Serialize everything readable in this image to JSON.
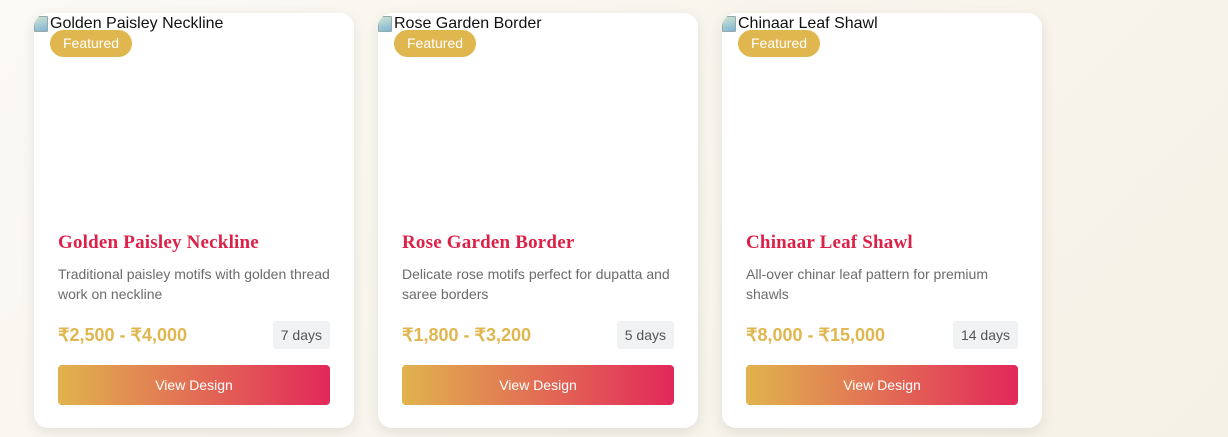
{
  "cards": [
    {
      "image_alt": "Golden Paisley Neckline",
      "badge": "Featured",
      "title": "Golden Paisley Neckline",
      "description": "Traditional paisley motifs with golden thread work on neckline",
      "price": "₹2,500 - ₹4,000",
      "days": "7 days",
      "button": "View Design"
    },
    {
      "image_alt": "Rose Garden Border",
      "badge": "Featured",
      "title": "Rose Garden Border",
      "description": "Delicate rose motifs perfect for dupatta and saree borders",
      "price": "₹1,800 - ₹3,200",
      "days": "5 days",
      "button": "View Design"
    },
    {
      "image_alt": "Chinaar Leaf Shawl",
      "badge": "Featured",
      "title": "Chinaar Leaf Shawl",
      "description": "All-over chinar leaf pattern for premium shawls",
      "price": "₹8,000 - ₹15,000",
      "days": "14 days",
      "button": "View Design"
    }
  ],
  "colors": {
    "accent_gold": "#e0b64f",
    "accent_crimson": "#dc2148",
    "background": "#faf7f0"
  },
  "icons": [
    "broken-image-icon"
  ]
}
